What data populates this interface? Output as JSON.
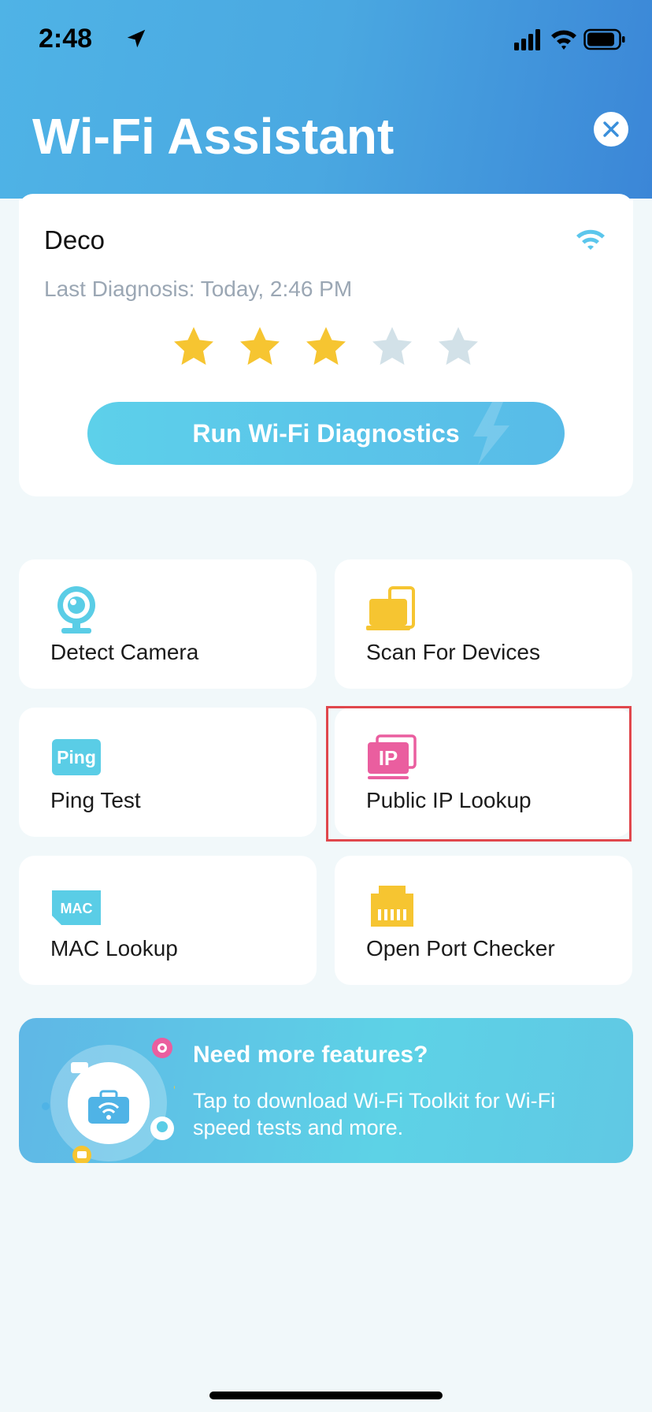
{
  "status_bar": {
    "time": "2:48"
  },
  "header": {
    "title": "Wi-Fi Assistant"
  },
  "network_card": {
    "name": "Deco",
    "last_diagnosis": "Last Diagnosis: Today, 2:46 PM",
    "rating": 3,
    "rating_max": 5,
    "run_button_label": "Run Wi-Fi Diagnostics"
  },
  "tools": [
    {
      "label": "Detect Camera",
      "icon": "camera-icon"
    },
    {
      "label": "Scan For Devices",
      "icon": "devices-icon"
    },
    {
      "label": "Ping Test",
      "icon": "ping-icon",
      "icon_text": "Ping"
    },
    {
      "label": "Public IP Lookup",
      "icon": "ip-icon",
      "icon_text": "IP"
    },
    {
      "label": "MAC Lookup",
      "icon": "mac-icon",
      "icon_text": "MAC"
    },
    {
      "label": "Open Port Checker",
      "icon": "ethernet-port-icon"
    }
  ],
  "banner": {
    "title": "Need more features?",
    "subtitle": "Tap to download Wi-Fi Toolkit for Wi-Fi speed tests and more."
  },
  "colors": {
    "accent": "#4fb3e6",
    "star_filled": "#f6c531",
    "star_empty": "#d2e1e8",
    "highlight": "#e0474c",
    "camera": "#5acde6",
    "devices": "#f6c531",
    "ping": "#5acde6",
    "ip": "#ea5e9f",
    "mac": "#5acde6",
    "port": "#f6c531"
  }
}
